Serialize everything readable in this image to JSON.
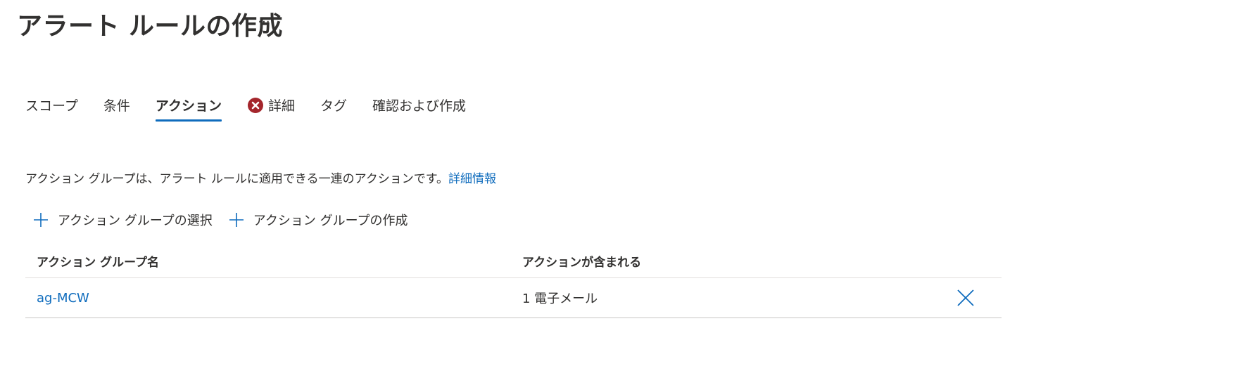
{
  "header": {
    "title": "アラート ルールの作成",
    "more_label": "···"
  },
  "tabs": [
    {
      "label": "スコープ",
      "active": false,
      "error": false
    },
    {
      "label": "条件",
      "active": false,
      "error": false
    },
    {
      "label": "アクション",
      "active": true,
      "error": false
    },
    {
      "label": "詳細",
      "active": false,
      "error": true
    },
    {
      "label": "タグ",
      "active": false,
      "error": false
    },
    {
      "label": "確認および作成",
      "active": false,
      "error": false
    }
  ],
  "description": {
    "text": "アクション グループは、アラート ルールに適用できる一連のアクションです。",
    "link": "詳細情報"
  },
  "commands": {
    "select_label": "アクション グループの選択",
    "create_label": "アクション グループの作成"
  },
  "table": {
    "columns": [
      "アクション グループ名",
      "アクションが含まれる"
    ],
    "rows": [
      {
        "name": "ag-MCW",
        "actions": "1 電子メール"
      }
    ]
  },
  "colors": {
    "accent": "#0f6cbd",
    "error": "#a4262c",
    "text": "#323130"
  },
  "icons": {
    "more": "ellipsis-icon",
    "error": "error-circle-icon",
    "add": "plus-icon",
    "delete": "close-icon"
  }
}
